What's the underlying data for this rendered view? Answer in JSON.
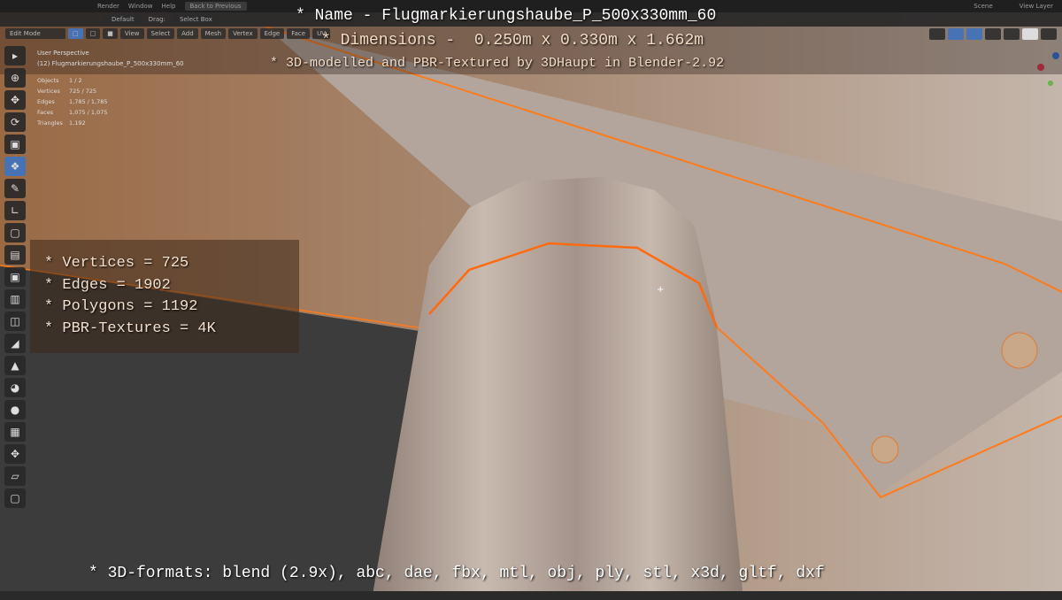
{
  "topbar": {
    "menu": [
      "Render",
      "Window",
      "Help"
    ],
    "back_button": "Back to Previous",
    "scene": "Scene",
    "view_layer": "View Layer"
  },
  "tool_header": {
    "orientation": "Default",
    "drag_label": "Drag:",
    "drag_value": "Select Box"
  },
  "viewport_header": {
    "mode": "Edit Mode",
    "menus": [
      "View",
      "Select",
      "Add",
      "Mesh",
      "Vertex",
      "Edge",
      "Face",
      "UV"
    ]
  },
  "viewport_info": {
    "perspective": "User Perspective",
    "object": "(12) Flugmarkierungshaube_P_500x330mm_60",
    "stats": [
      {
        "k": "Objects",
        "v": "1 / 2"
      },
      {
        "k": "Vertices",
        "v": "725 / 725"
      },
      {
        "k": "Edges",
        "v": "1,785 / 1,785"
      },
      {
        "k": "Faces",
        "v": "1,075 / 1,075"
      },
      {
        "k": "Triangles",
        "v": "1,192"
      }
    ]
  },
  "overlay": {
    "name": "* Name - Flugmarkierungshaube_P_500x330mm_60",
    "dimensions": "* Dimensions -  0.250m x 0.330m x 1.662m",
    "credit": "* 3D-modelled and PBR-Textured by 3DHaupt in Blender-2.92",
    "stats": [
      "* Vertices = 725",
      "* Edges = 1902",
      "* Polygons = 1192",
      "* PBR-Textures = 4K"
    ],
    "formats": "* 3D-formats: blend (2.9x), abc, dae, fbx, mtl, obj, ply, stl, x3d, gltf, dxf"
  },
  "colors": {
    "accent": "#4772b3",
    "edge_select": "#ff7a1a",
    "model": "#b5a59a"
  }
}
